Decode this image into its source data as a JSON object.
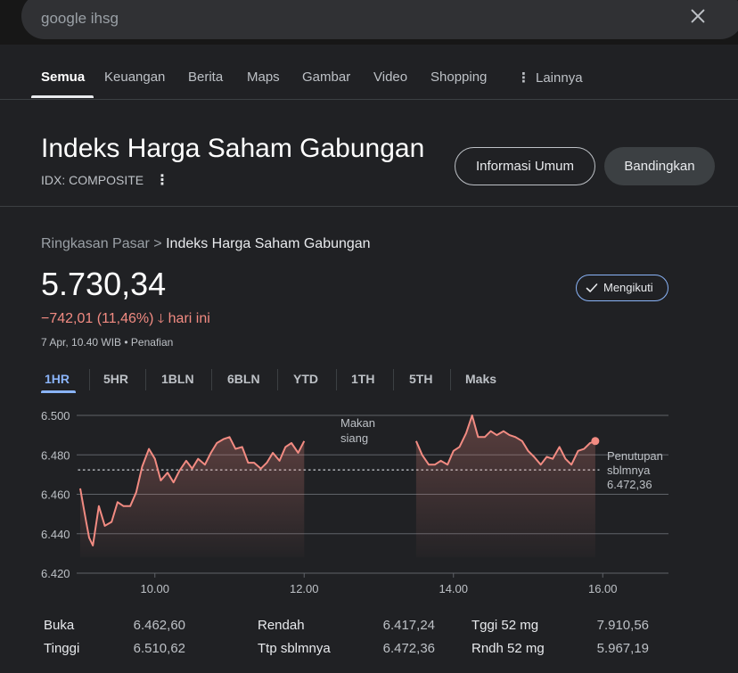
{
  "search": {
    "query": "google ihsg"
  },
  "tabs": [
    {
      "label": "Semua",
      "active": true
    },
    {
      "label": "Keuangan"
    },
    {
      "label": "Berita"
    },
    {
      "label": "Maps"
    },
    {
      "label": "Gambar"
    },
    {
      "label": "Video"
    },
    {
      "label": "Shopping"
    },
    {
      "label": "Lainnya"
    }
  ],
  "knowledge_panel": {
    "title": "Indeks Harga Saham Gabungan",
    "ticker": "IDX: COMPOSITE",
    "info_button": "Informasi Umum",
    "compare_button": "Bandingkan"
  },
  "market": {
    "breadcrumb_parent": "Ringkasan Pasar",
    "breadcrumb_sep": ">",
    "breadcrumb_current": "Indeks Harga Saham Gabungan",
    "price": "5.730,34",
    "change": "−742,01 (11,46%)",
    "change_arrow": "🡓",
    "change_period": "hari ini",
    "timestamp": "7 Apr, 10.40 WIB • Penafian",
    "follow_label": "Mengikuti",
    "negative_color": "#f28b82",
    "accent_color": "#8ab4f8"
  },
  "ranges": [
    {
      "label": "1HR",
      "active": true
    },
    {
      "label": "5HR"
    },
    {
      "label": "1BLN"
    },
    {
      "label": "6BLN"
    },
    {
      "label": "YTD"
    },
    {
      "label": "1TH"
    },
    {
      "label": "5TH"
    },
    {
      "label": "Maks"
    }
  ],
  "chart_data": {
    "type": "line",
    "yticks": [
      "6.500",
      "6.480",
      "6.460",
      "6.440",
      "6.420"
    ],
    "ytick_values": [
      6500,
      6480,
      6460,
      6440,
      6420
    ],
    "ylim": [
      6420,
      6500
    ],
    "xticks": [
      "10.00",
      "12.00",
      "14.00",
      "16.00"
    ],
    "xtick_values": [
      10,
      12,
      14,
      16
    ],
    "xlim": [
      9,
      17
    ],
    "lunch_label": "Makan siang",
    "prev_close_label": "Penutupan sblmnya",
    "prev_close_value": "6.472,36",
    "prev_close": 6472.36,
    "line_color": "#f28b82",
    "grid": true,
    "sessions": [
      {
        "x": [
          9.0,
          9.08,
          9.12,
          9.17,
          9.25,
          9.33,
          9.42,
          9.5,
          9.58,
          9.67,
          9.75,
          9.83,
          9.92,
          10.0,
          10.08,
          10.17,
          10.25,
          10.33,
          10.42,
          10.5,
          10.58,
          10.67,
          10.75,
          10.83,
          10.92,
          11.0,
          11.08,
          11.17,
          11.25,
          11.33,
          11.42,
          11.5,
          11.58,
          11.67,
          11.75,
          11.83,
          11.92,
          12.0
        ],
        "y": [
          6463,
          6446,
          6438,
          6434,
          6454,
          6444,
          6446,
          6456,
          6454,
          6454,
          6461,
          6474,
          6483,
          6478,
          6467,
          6471,
          6466,
          6472,
          6477,
          6473,
          6478,
          6475,
          6481,
          6486,
          6488,
          6489,
          6483,
          6484,
          6476,
          6476,
          6473,
          6476,
          6481,
          6477,
          6484,
          6486,
          6481,
          6487
        ]
      },
      {
        "x": [
          13.5,
          13.58,
          13.67,
          13.75,
          13.83,
          13.92,
          14.0,
          14.08,
          14.17,
          14.25,
          14.33,
          14.42,
          14.5,
          14.58,
          14.67,
          14.75,
          14.83,
          14.92,
          15.0,
          15.08,
          15.17,
          15.25,
          15.33,
          15.42,
          15.5,
          15.58,
          15.67,
          15.75,
          15.83,
          15.9
        ],
        "y": [
          6487,
          6480,
          6475,
          6475,
          6477,
          6475,
          6482,
          6484,
          6491,
          6500,
          6489,
          6489,
          6492,
          6490,
          6492,
          6490,
          6489,
          6487,
          6482,
          6479,
          6475,
          6479,
          6478,
          6484,
          6478,
          6475,
          6482,
          6483,
          6486,
          6487
        ]
      }
    ]
  },
  "stats": [
    {
      "label": "Buka",
      "value": "6.462,60"
    },
    {
      "label": "Tinggi",
      "value": "6.510,62"
    },
    {
      "label": "Rendah",
      "value": "6.417,24"
    },
    {
      "label": "Ttp sblmnya",
      "value": "6.472,36"
    },
    {
      "label": "Tggi 52 mg",
      "value": "7.910,56"
    },
    {
      "label": "Rndh 52 mg",
      "value": "5.967,19"
    }
  ]
}
